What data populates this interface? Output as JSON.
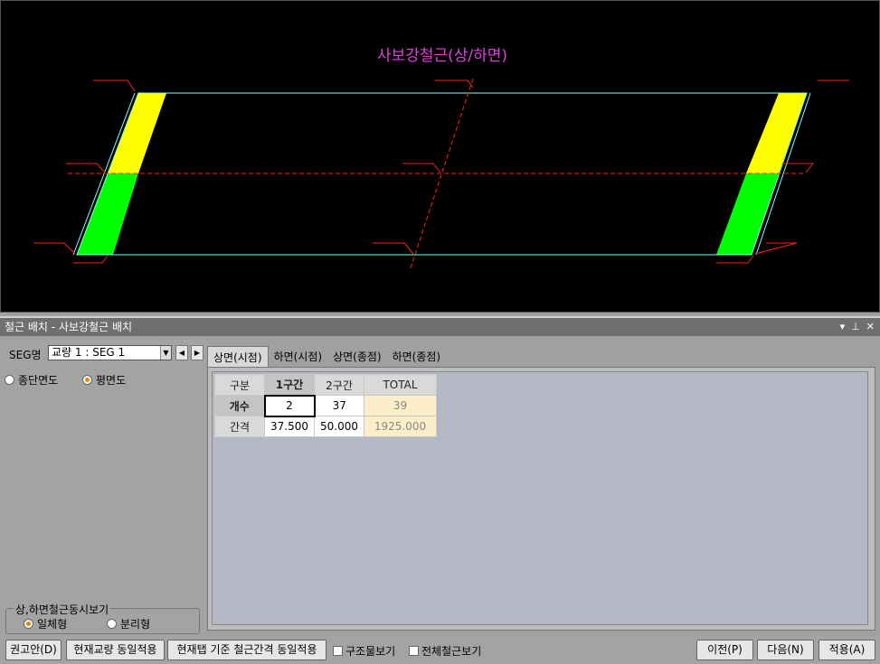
{
  "drawing": {
    "title": "사보강철근(상/하면)"
  },
  "panel": {
    "title": "철근 배치 - 사보강철근 배치",
    "icons": [
      "▾",
      "📌",
      "✕"
    ]
  },
  "left": {
    "seg_label": "SEG명",
    "seg_value": "교량 1 : SEG 1",
    "view_options": [
      {
        "label": "종단면도",
        "selected": false
      },
      {
        "label": "평면도",
        "selected": true
      }
    ],
    "sim_group_title": "상,하면철근동시보기",
    "sim_options": [
      {
        "label": "일체형",
        "selected": true
      },
      {
        "label": "분리형",
        "selected": false
      }
    ]
  },
  "tabs": [
    "상면(시점)",
    "하면(시점)",
    "상면(종점)",
    "하면(종점)"
  ],
  "table": {
    "headers": [
      "구분",
      "1구간",
      "2구간",
      "TOTAL"
    ],
    "rows": [
      {
        "label": "개수",
        "values": [
          "2",
          "37"
        ],
        "total": "39"
      },
      {
        "label": "간격",
        "values": [
          "37.500",
          "50.000"
        ],
        "total": "1925.000"
      }
    ]
  },
  "bottom": {
    "recommend": "권고안(D)",
    "same_bridge": "현재교량 동일적용",
    "same_tab": "현재탭 기준 철근간격 동일적용",
    "chk_structure": "구조물보기",
    "chk_all": "전체철근보기",
    "prev": "이전(P)",
    "next": "다음(N)",
    "apply": "적용(A)"
  },
  "colors": {
    "top_fill": "#ffff00",
    "bottom_fill": "#00ff00",
    "outline": "#7fffff",
    "dim": "#ff2020",
    "title": "#e040e0"
  }
}
